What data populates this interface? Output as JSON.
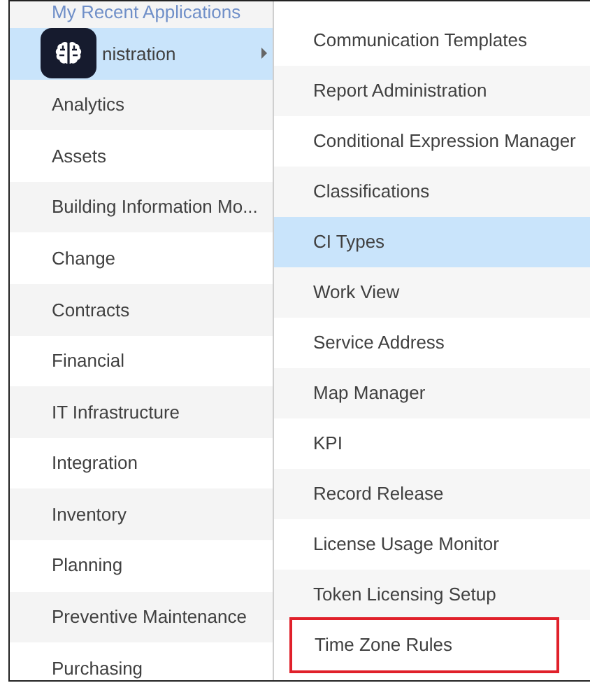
{
  "applications_menu": {
    "items": [
      {
        "label": "My Recent Applications",
        "selected": false,
        "submenu": false
      },
      {
        "label": "nistration",
        "selected": true,
        "submenu": true
      },
      {
        "label": "Analytics",
        "selected": false,
        "submenu": false
      },
      {
        "label": "Assets",
        "selected": false,
        "submenu": false
      },
      {
        "label": "Building Information Mo...",
        "selected": false,
        "submenu": false
      },
      {
        "label": "Change",
        "selected": false,
        "submenu": false
      },
      {
        "label": "Contracts",
        "selected": false,
        "submenu": false
      },
      {
        "label": "Financial",
        "selected": false,
        "submenu": false
      },
      {
        "label": "IT Infrastructure",
        "selected": false,
        "submenu": false
      },
      {
        "label": "Integration",
        "selected": false,
        "submenu": false
      },
      {
        "label": "Inventory",
        "selected": false,
        "submenu": false
      },
      {
        "label": "Planning",
        "selected": false,
        "submenu": false
      },
      {
        "label": "Preventive Maintenance",
        "selected": false,
        "submenu": false
      },
      {
        "label": "Purchasing",
        "selected": false,
        "submenu": false
      }
    ]
  },
  "submenu": {
    "items": [
      {
        "label": "Communication Templates",
        "selected": false,
        "outlined": false
      },
      {
        "label": "Report Administration",
        "selected": false,
        "outlined": false
      },
      {
        "label": "Conditional Expression Manager",
        "selected": false,
        "outlined": false
      },
      {
        "label": "Classifications",
        "selected": false,
        "outlined": false
      },
      {
        "label": "CI Types",
        "selected": true,
        "outlined": false
      },
      {
        "label": "Work View",
        "selected": false,
        "outlined": false
      },
      {
        "label": "Service Address",
        "selected": false,
        "outlined": false
      },
      {
        "label": "Map Manager",
        "selected": false,
        "outlined": false
      },
      {
        "label": "KPI",
        "selected": false,
        "outlined": false
      },
      {
        "label": "Record Release",
        "selected": false,
        "outlined": false
      },
      {
        "label": "License Usage Monitor",
        "selected": false,
        "outlined": false
      },
      {
        "label": "Token Licensing Setup",
        "selected": false,
        "outlined": false
      },
      {
        "label": "Time Zone Rules",
        "selected": false,
        "outlined": true
      }
    ]
  }
}
